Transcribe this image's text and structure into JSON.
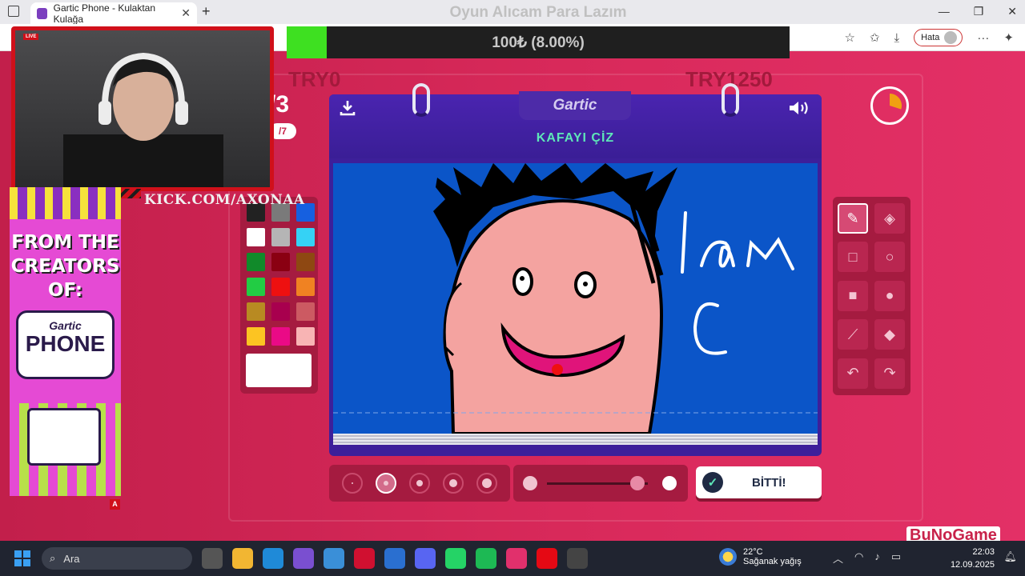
{
  "browser": {
    "tab_title": "Gartic Phone - Kulaktan Kulağa",
    "profile_status": "Hata"
  },
  "stream": {
    "overlay_title": "Oyun Alıcam Para Lazım",
    "goal_progress_text": "100₺ (8.00%)",
    "goal_progress_percent": 8,
    "try_left": "TRY0",
    "try_right": "TRY1250",
    "channel": "KICK.COM/AXONAA",
    "live_label": "LIVE",
    "promo_lines": [
      "FROM THE",
      "CREATORS",
      "OF:"
    ],
    "promo_logo_top": "Gartic",
    "promo_logo_bottom": "PHONE",
    "corner_badge": "A",
    "watermark": "BuNoGame"
  },
  "game": {
    "round_big": "/3",
    "round_small": "/7",
    "logo": "Gartic",
    "prompt_title": "KAFAYI ÇİZ",
    "timer_fraction_elapsed": 0.3,
    "timer_color": "#f0a012",
    "palette": [
      "#222222",
      "#7a7a7a",
      "#1660e0",
      "#ffffff",
      "#b5b5b5",
      "#35d2f5",
      "#118a2a",
      "#8a0012",
      "#8e4812",
      "#22cc44",
      "#ee1010",
      "#f08222",
      "#b88a22",
      "#a8004e",
      "#cc5a62",
      "#fcc422",
      "#ea0a86",
      "#f8b4b4"
    ],
    "current_color": "#ffffff",
    "tools": [
      {
        "name": "pencil-tool-icon",
        "glyph": "✎",
        "active": true
      },
      {
        "name": "eraser-tool-icon",
        "glyph": "◈",
        "active": false
      },
      {
        "name": "rectangle-outline-tool-icon",
        "glyph": "□",
        "active": false
      },
      {
        "name": "ellipse-outline-tool-icon",
        "glyph": "○",
        "active": false
      },
      {
        "name": "rectangle-fill-tool-icon",
        "glyph": "■",
        "active": false
      },
      {
        "name": "ellipse-fill-tool-icon",
        "glyph": "●",
        "active": false
      },
      {
        "name": "line-tool-icon",
        "glyph": "⟋",
        "active": false
      },
      {
        "name": "fill-bucket-tool-icon",
        "glyph": "◆",
        "active": false
      },
      {
        "name": "undo-tool-icon",
        "glyph": "↶",
        "active": false
      },
      {
        "name": "redo-tool-icon",
        "glyph": "↷",
        "active": false
      }
    ],
    "brush_size_active_index": 1,
    "opacity_level": 0.9,
    "done_label": "BİTTİ!"
  },
  "taskbar": {
    "search_placeholder": "Ara",
    "weather_temp": "22°C",
    "weather_desc": "Sağanak yağış",
    "time": "22:03",
    "date": "12.09.2025"
  }
}
